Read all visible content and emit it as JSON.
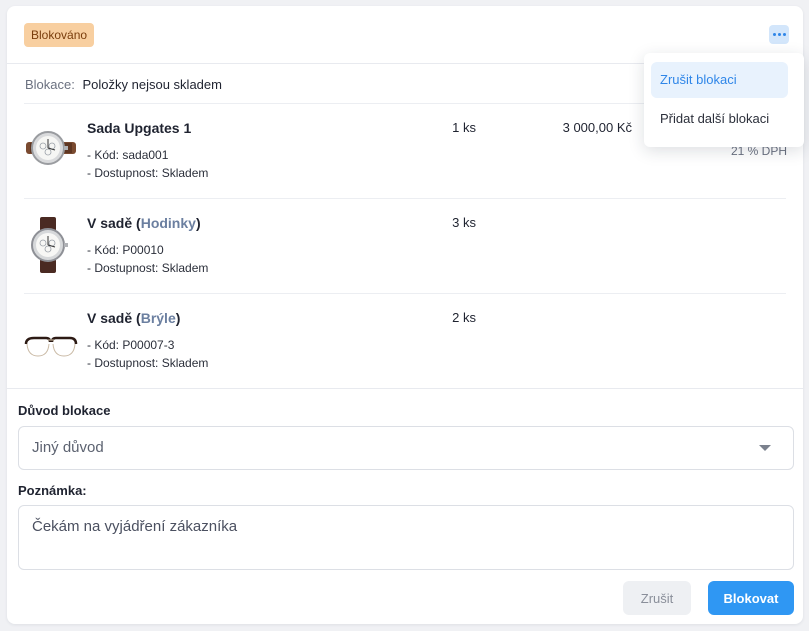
{
  "status_badge": "Blokováno",
  "blocking": {
    "label": "Blokace:",
    "value": "Položky nejsou skladem"
  },
  "menu": {
    "items": [
      "Zrušit blokaci",
      "Přidat další blokaci"
    ]
  },
  "items": [
    {
      "name": "Sada Upgates 1",
      "set_prefix": "",
      "set_name": "",
      "set_suffix": "",
      "code": "- Kód: sada001",
      "availability": "- Dostupnost: Skladem",
      "qty": "1 ks",
      "price": "3 000,00 Kč",
      "vat": "21 % DPH",
      "image": "watch-brown-strap"
    },
    {
      "name": "V sadě",
      "set_prefix": " (",
      "set_name": "Hodinky",
      "set_suffix": ")",
      "code": "- Kód: P00010",
      "availability": "- Dostupnost: Skladem",
      "qty": "3 ks",
      "image": "watch-dark-strap"
    },
    {
      "name": "V sadě",
      "set_prefix": " (",
      "set_name": "Brýle",
      "set_suffix": ")",
      "code": "- Kód: P00007-3",
      "availability": "- Dostupnost: Skladem",
      "qty": "2 ks",
      "image": "glasses"
    }
  ],
  "form": {
    "reason_label": "Důvod blokace",
    "reason_value": "Jiný důvod",
    "note_label": "Poznámka:",
    "note_value": "Čekám na vyjádření zákazníka",
    "cancel_label": "Zrušit",
    "submit_label": "Blokovat"
  },
  "colors": {
    "badge": "#f8cfa0",
    "accent": "#2f97f3",
    "set_name": "#6b7fa0"
  }
}
